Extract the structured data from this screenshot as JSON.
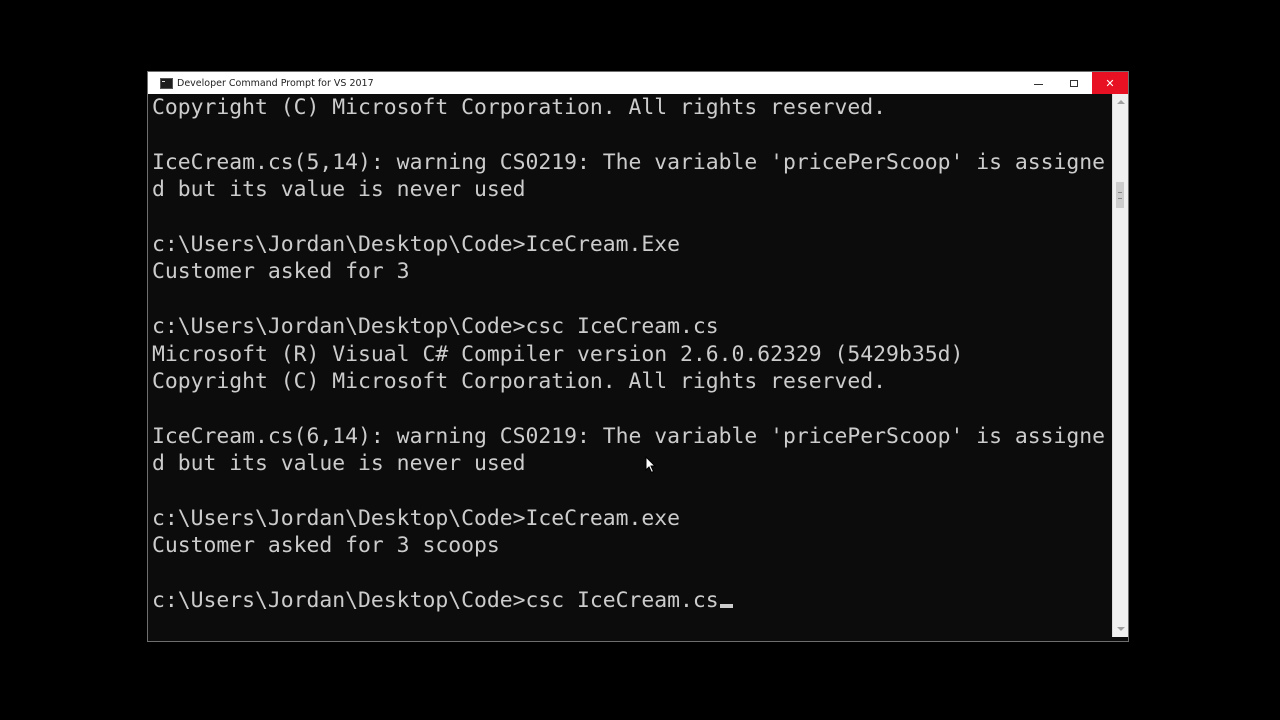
{
  "window": {
    "title": "Developer Command Prompt for VS 2017",
    "controls": {
      "minimize": "minimize-icon",
      "maximize": "maximize-icon",
      "close": "✕"
    }
  },
  "console": {
    "text_color": "#cccccc",
    "background": "#0c0c0c",
    "lines": [
      "Copyright (C) Microsoft Corporation. All rights reserved.",
      "",
      "IceCream.cs(5,14): warning CS0219: The variable 'pricePerScoop' is assigne",
      "d but its value is never used",
      "",
      "c:\\Users\\Jordan\\Desktop\\Code>IceCream.Exe",
      "Customer asked for 3",
      "",
      "c:\\Users\\Jordan\\Desktop\\Code>csc IceCream.cs",
      "Microsoft (R) Visual C# Compiler version 2.6.0.62329 (5429b35d)",
      "Copyright (C) Microsoft Corporation. All rights reserved.",
      "",
      "IceCream.cs(6,14): warning CS0219: The variable 'pricePerScoop' is assigne",
      "d but its value is never used",
      "",
      "c:\\Users\\Jordan\\Desktop\\Code>IceCream.exe",
      "Customer asked for 3 scoops",
      "",
      "c:\\Users\\Jordan\\Desktop\\Code>csc IceCream.cs"
    ]
  },
  "colors": {
    "close_button": "#e81123",
    "titlebar": "#ffffff",
    "desktop": "#000000"
  }
}
